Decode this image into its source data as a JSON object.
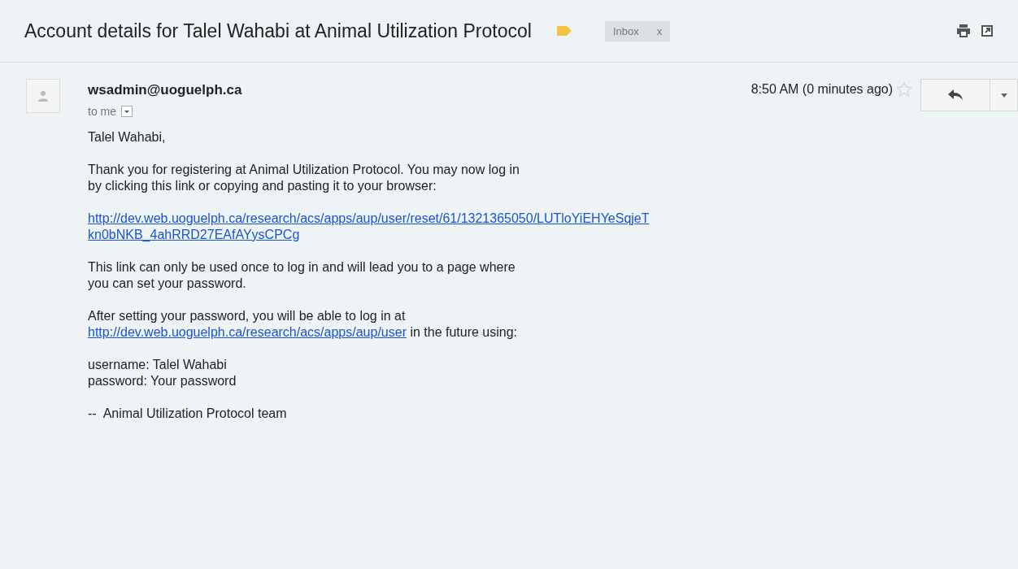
{
  "subject": "Account details for Talel Wahabi at Animal Utilization Protocol",
  "labels": [
    {
      "text": "Inbox",
      "remove": "x"
    }
  ],
  "message": {
    "sender": "wsadmin@uoguelph.ca",
    "recipient": "to me",
    "time": "8:50 AM (0 minutes ago)",
    "starred": false,
    "body": [
      [
        [
          {
            "kind": "text",
            "text": "Talel Wahabi,"
          }
        ]
      ],
      [
        [
          {
            "kind": "text",
            "text": "Thank you for registering at Animal Utilization Protocol. You may now log in"
          }
        ],
        [
          {
            "kind": "text",
            "text": "by clicking this link or copying and pasting it to your browser:"
          }
        ]
      ],
      [
        [
          {
            "kind": "link",
            "text": "http://dev.web.uoguelph.ca/research/acs/apps/aup/user/reset/61/1321365050/LUTloYiEHYeSqjeT"
          }
        ],
        [
          {
            "kind": "link",
            "text": "kn0bNKB_4ahRRD27EAfAYysCPCg"
          }
        ]
      ],
      [
        [
          {
            "kind": "text",
            "text": "This link can only be used once to log in and will lead you to a page where"
          }
        ],
        [
          {
            "kind": "text",
            "text": "you can set your password."
          }
        ]
      ],
      [
        [
          {
            "kind": "text",
            "text": "After setting your password, you will be able to log in at"
          }
        ],
        [
          {
            "kind": "link",
            "text": "http://dev.web.uoguelph.ca/research/acs/apps/aup/user"
          },
          {
            "kind": "text",
            "text": " in the future using:"
          }
        ]
      ],
      [
        [
          {
            "kind": "text",
            "text": "username: Talel Wahabi"
          }
        ],
        [
          {
            "kind": "text",
            "text": "password: Your password"
          }
        ]
      ],
      [
        [
          {
            "kind": "text",
            "text": "--  Animal Utilization Protocol team"
          }
        ]
      ]
    ]
  }
}
